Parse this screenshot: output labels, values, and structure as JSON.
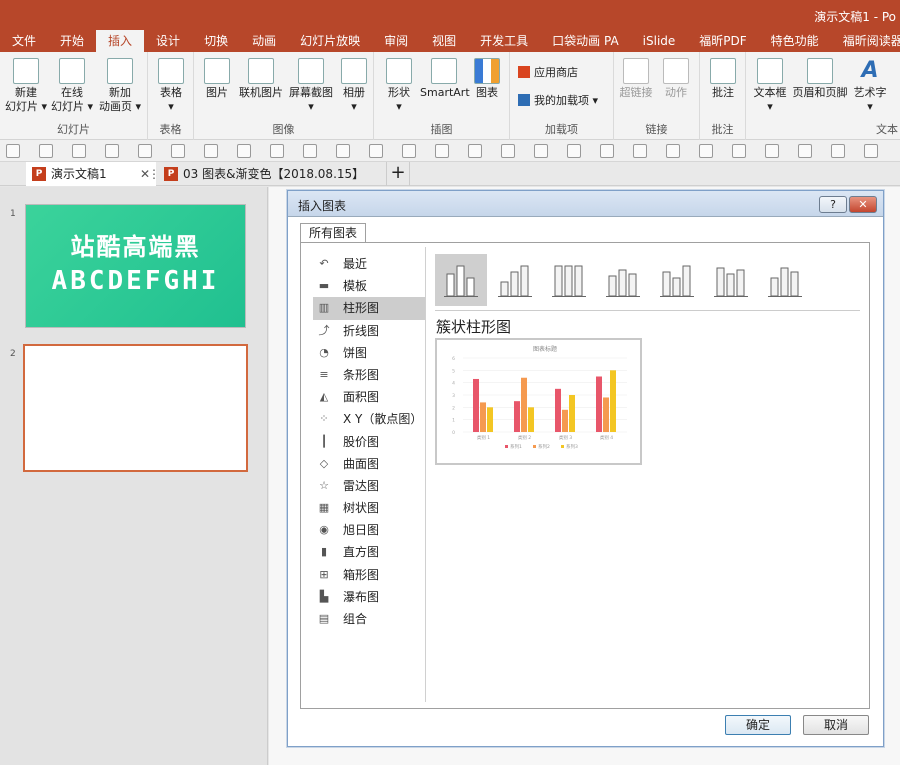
{
  "window": {
    "title": "演示文稿1 - Po"
  },
  "menu": [
    "文件",
    "开始",
    "插入",
    "设计",
    "切换",
    "动画",
    "幻灯片放映",
    "审阅",
    "视图",
    "开发工具",
    "口袋动画 PA",
    "iSlide",
    "福昕PDF",
    "特色功能",
    "福昕阅读器"
  ],
  "menu_active": "插入",
  "ribbon": {
    "slides": {
      "new_slide": "新建\n幻灯片 ▾",
      "online_slide": "在线\n幻灯片 ▾",
      "new_anim_page": "新加\n动画页 ▾",
      "label": "幻灯片"
    },
    "tables": {
      "table": "表格\n▾",
      "label": "表格"
    },
    "images": {
      "picture": "图片",
      "online_picture": "联机图片",
      "screenshot": "屏幕截图\n▾",
      "album": "相册\n▾",
      "label": "图像"
    },
    "illustrations": {
      "shapes": "形状\n▾",
      "smartart": "SmartArt",
      "chart": "图表",
      "label": "插图"
    },
    "addins": {
      "store": "应用商店",
      "my_addins": "我的加载项 ▾",
      "label": "加载项"
    },
    "links": {
      "hyperlink": "超链接",
      "action": "动作",
      "label": "链接"
    },
    "comments": {
      "comment": "批注",
      "label": "批注"
    },
    "text": {
      "textbox": "文本框\n▾",
      "header_footer": "页眉和页脚",
      "wordart": "艺术字\n▾",
      "label": "文本"
    }
  },
  "tabs": [
    {
      "label": "演示文稿1",
      "close": "✕",
      "more": "⋮"
    },
    {
      "label": "03 图表&渐变色【2018.08.15】"
    }
  ],
  "new_tab": "+",
  "slides": [
    {
      "num": "1",
      "line1": "站酷高端黑",
      "line2": "ABCDEFGHI"
    },
    {
      "num": "2"
    }
  ],
  "dialog": {
    "title": "插入图表",
    "help": "?",
    "close": "✕",
    "tab": "所有图表",
    "categories": [
      "最近",
      "模板",
      "柱形图",
      "折线图",
      "饼图",
      "条形图",
      "面积图",
      "X Y（散点图）",
      "股价图",
      "曲面图",
      "雷达图",
      "树状图",
      "旭日图",
      "直方图",
      "箱形图",
      "瀑布图",
      "组合"
    ],
    "selected_category": "柱形图",
    "subtype_title": "簇状柱形图",
    "ok": "确定",
    "cancel": "取消"
  },
  "colors": {
    "accent": "#b7472a",
    "series1": "#e8566a",
    "series2": "#f59a50",
    "series3": "#f3c623"
  },
  "chart_data": {
    "type": "bar",
    "title": "图表标题",
    "categories": [
      "类别 1",
      "类别 2",
      "类别 3",
      "类别 4"
    ],
    "series": [
      {
        "name": "系列1",
        "values": [
          4.3,
          2.5,
          3.5,
          4.5
        ]
      },
      {
        "name": "系列2",
        "values": [
          2.4,
          4.4,
          1.8,
          2.8
        ]
      },
      {
        "name": "系列3",
        "values": [
          2,
          2,
          3,
          5
        ]
      }
    ],
    "ylim": [
      0,
      6
    ],
    "yticks": [
      0,
      1,
      2,
      3,
      4,
      5,
      6
    ],
    "legend": "bottom",
    "grid": true
  }
}
